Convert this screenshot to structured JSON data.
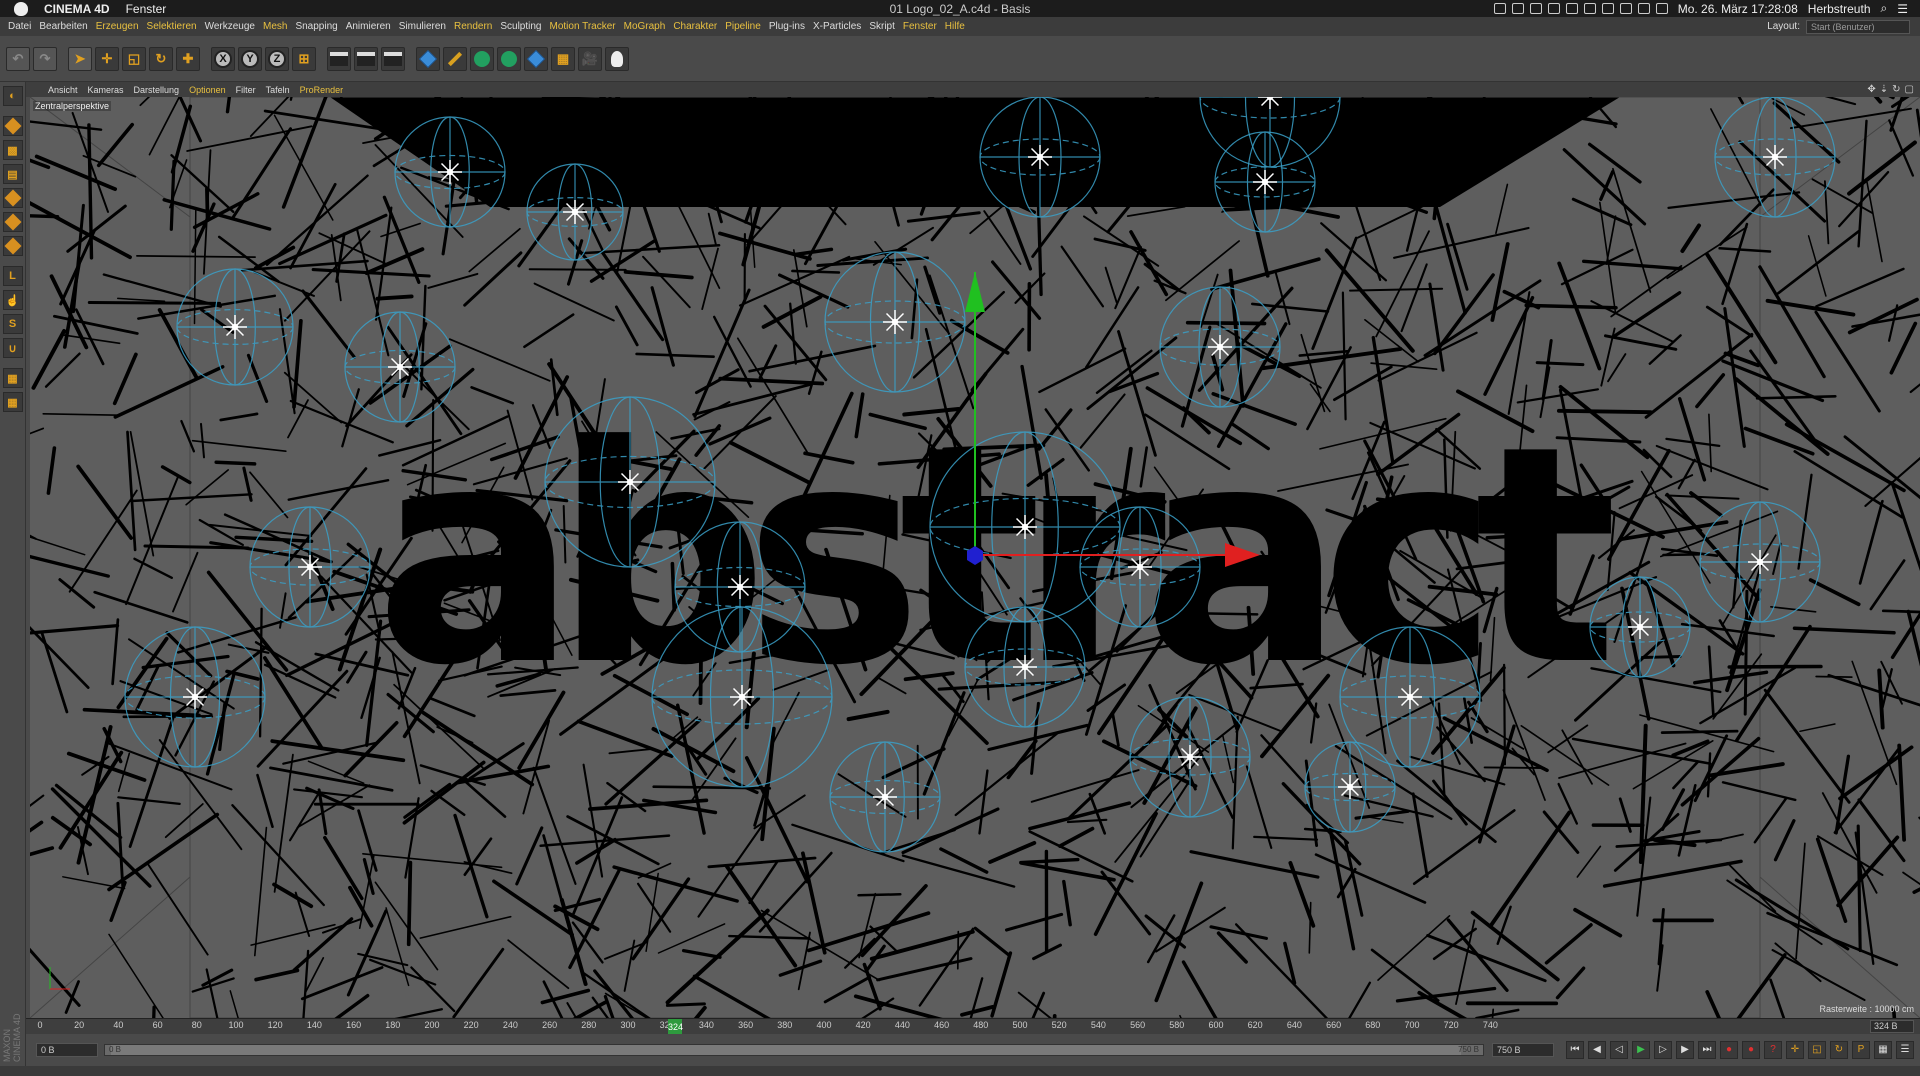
{
  "mac_menubar": {
    "app_name": "CINEMA 4D",
    "menu": "Fenster",
    "window_title": "01 Logo_02_A.c4d - Basis",
    "datetime": "Mo. 26. März  17:28:08",
    "user": "Herbstreuth"
  },
  "main_menu": {
    "items": [
      {
        "label": "Datei",
        "hl": false
      },
      {
        "label": "Bearbeiten",
        "hl": false
      },
      {
        "label": "Erzeugen",
        "hl": true
      },
      {
        "label": "Selektieren",
        "hl": true
      },
      {
        "label": "Werkzeuge",
        "hl": false
      },
      {
        "label": "Mesh",
        "hl": true
      },
      {
        "label": "Snapping",
        "hl": false
      },
      {
        "label": "Animieren",
        "hl": false
      },
      {
        "label": "Simulieren",
        "hl": false
      },
      {
        "label": "Rendern",
        "hl": true
      },
      {
        "label": "Sculpting",
        "hl": false
      },
      {
        "label": "Motion Tracker",
        "hl": true
      },
      {
        "label": "MoGraph",
        "hl": true
      },
      {
        "label": "Charakter",
        "hl": true
      },
      {
        "label": "Pipeline",
        "hl": true
      },
      {
        "label": "Plug-ins",
        "hl": false
      },
      {
        "label": "X-Particles",
        "hl": false
      },
      {
        "label": "Skript",
        "hl": false
      },
      {
        "label": "Fenster",
        "hl": true
      },
      {
        "label": "Hilfe",
        "hl": true
      }
    ],
    "layout_label": "Layout:",
    "layout_value": "Start (Benutzer)"
  },
  "toolbar": {
    "axis_x": "X",
    "axis_y": "Y",
    "axis_z": "Z"
  },
  "viewport_menu": {
    "items": [
      {
        "label": "Ansicht",
        "hl": false
      },
      {
        "label": "Kameras",
        "hl": false
      },
      {
        "label": "Darstellung",
        "hl": false
      },
      {
        "label": "Optionen",
        "hl": true
      },
      {
        "label": "Filter",
        "hl": false
      },
      {
        "label": "Tafeln",
        "hl": false
      },
      {
        "label": "ProRender",
        "hl": true
      }
    ]
  },
  "viewport": {
    "camera_label": "Zentralperspektive",
    "logo_text": "abstract",
    "grid_info": "Rasterweite : 10000 cm",
    "colors": {
      "background": "#5a5a5a",
      "strands": "#000000",
      "wireframe": "#3aa0c8",
      "axis_x": "#e02020",
      "axis_y": "#20c020",
      "axis_z": "#2020d0"
    }
  },
  "timeline": {
    "ticks": [
      "0",
      "20",
      "40",
      "60",
      "80",
      "100",
      "120",
      "140",
      "160",
      "180",
      "200",
      "220",
      "240",
      "260",
      "280",
      "300",
      "320",
      "340",
      "360",
      "380",
      "400",
      "420",
      "440",
      "460",
      "480",
      "500",
      "520",
      "540",
      "560",
      "580",
      "600",
      "620",
      "640",
      "660",
      "680",
      "700",
      "720",
      "740"
    ],
    "current_frame": "324",
    "end_frame": "324 B"
  },
  "transport": {
    "start_field": "0 B",
    "slider_left": "0 B",
    "slider_right": "750 B",
    "end_field": "750 B"
  },
  "left_logo": "MAXON CINEMA 4D"
}
